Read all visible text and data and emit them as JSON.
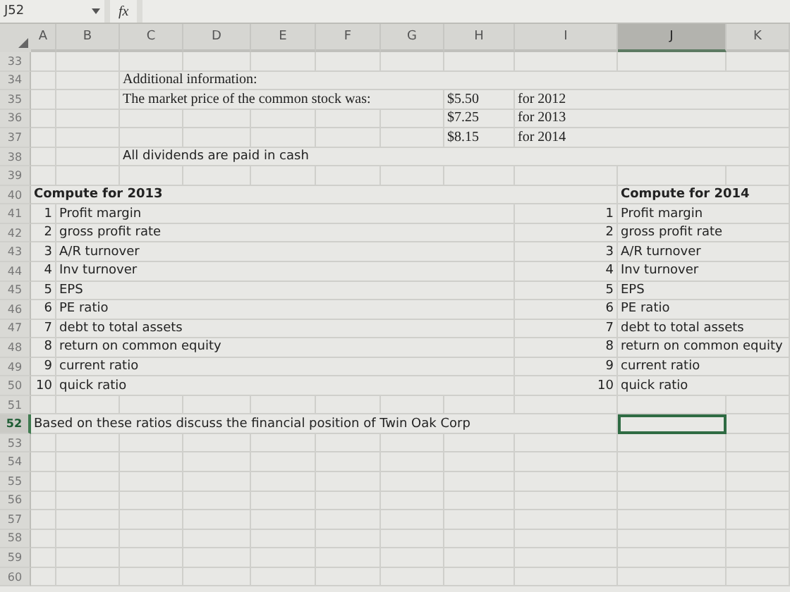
{
  "formula_bar": {
    "name_box": "J52",
    "function_label": "fx"
  },
  "columns": [
    {
      "letter": "A",
      "selected": false
    },
    {
      "letter": "B",
      "selected": false
    },
    {
      "letter": "C",
      "selected": false
    },
    {
      "letter": "D",
      "selected": false
    },
    {
      "letter": "E",
      "selected": false
    },
    {
      "letter": "F",
      "selected": false
    },
    {
      "letter": "G",
      "selected": false
    },
    {
      "letter": "H",
      "selected": false
    },
    {
      "letter": "I",
      "selected": false
    },
    {
      "letter": "J",
      "selected": true
    },
    {
      "letter": "K",
      "selected": false
    }
  ],
  "rows": [
    {
      "number": "33",
      "selected": false,
      "cells": {}
    },
    {
      "number": "34",
      "selected": false,
      "cells": {
        "C": {
          "kind": "typed",
          "text": "Additional information:"
        }
      }
    },
    {
      "number": "35",
      "selected": false,
      "cells": {
        "C": {
          "kind": "typed",
          "text": "The market price of the common stock was:"
        },
        "H": {
          "kind": "typed",
          "text": "$5.50"
        },
        "I": {
          "kind": "typed",
          "text": "for 2012"
        }
      }
    },
    {
      "number": "36",
      "selected": false,
      "cells": {
        "H": {
          "kind": "typed",
          "text": "$7.25"
        },
        "I": {
          "kind": "typed",
          "text": "for 2013"
        }
      }
    },
    {
      "number": "37",
      "selected": false,
      "cells": {
        "H": {
          "kind": "typed",
          "text": "$8.15"
        },
        "I": {
          "kind": "typed",
          "text": "for 2014"
        }
      }
    },
    {
      "number": "38",
      "selected": false,
      "cells": {
        "C": {
          "kind": "label",
          "text": "All dividends are paid in cash"
        }
      }
    },
    {
      "number": "39",
      "selected": false,
      "cells": {}
    },
    {
      "number": "40",
      "selected": false,
      "cells": {
        "A": {
          "kind": "heading",
          "text": "Compute for 2013"
        },
        "J": {
          "kind": "heading",
          "text": "Compute for 2014"
        }
      }
    },
    {
      "number": "41",
      "selected": false,
      "cells": {
        "A": {
          "kind": "index",
          "text": "1"
        },
        "B": {
          "kind": "label",
          "text": "Profit margin"
        },
        "I": {
          "kind": "index",
          "text": "1"
        },
        "J": {
          "kind": "label",
          "text": "Profit margin"
        }
      }
    },
    {
      "number": "42",
      "selected": false,
      "cells": {
        "A": {
          "kind": "index",
          "text": "2"
        },
        "B": {
          "kind": "label",
          "text": "gross profit rate"
        },
        "I": {
          "kind": "index",
          "text": "2"
        },
        "J": {
          "kind": "label",
          "text": "gross profit rate"
        }
      }
    },
    {
      "number": "43",
      "selected": false,
      "cells": {
        "A": {
          "kind": "index",
          "text": "3"
        },
        "B": {
          "kind": "label",
          "text": "A/R turnover"
        },
        "I": {
          "kind": "index",
          "text": "3"
        },
        "J": {
          "kind": "label",
          "text": "A/R turnover"
        }
      }
    },
    {
      "number": "44",
      "selected": false,
      "cells": {
        "A": {
          "kind": "index",
          "text": "4"
        },
        "B": {
          "kind": "label",
          "text": "Inv turnover"
        },
        "I": {
          "kind": "index",
          "text": "4"
        },
        "J": {
          "kind": "label",
          "text": "Inv turnover"
        }
      }
    },
    {
      "number": "45",
      "selected": false,
      "cells": {
        "A": {
          "kind": "index",
          "text": "5"
        },
        "B": {
          "kind": "label",
          "text": "EPS"
        },
        "I": {
          "kind": "index",
          "text": "5"
        },
        "J": {
          "kind": "label",
          "text": "EPS"
        }
      }
    },
    {
      "number": "46",
      "selected": false,
      "cells": {
        "A": {
          "kind": "index",
          "text": "6"
        },
        "B": {
          "kind": "label",
          "text": "PE ratio"
        },
        "I": {
          "kind": "index",
          "text": "6"
        },
        "J": {
          "kind": "label",
          "text": "PE ratio"
        }
      }
    },
    {
      "number": "47",
      "selected": false,
      "cells": {
        "A": {
          "kind": "index",
          "text": "7"
        },
        "B": {
          "kind": "label",
          "text": "debt to total assets"
        },
        "I": {
          "kind": "index",
          "text": "7"
        },
        "J": {
          "kind": "label",
          "text": "debt to total assets"
        }
      }
    },
    {
      "number": "48",
      "selected": false,
      "cells": {
        "A": {
          "kind": "index",
          "text": "8"
        },
        "B": {
          "kind": "label",
          "text": "return on common equity"
        },
        "I": {
          "kind": "index",
          "text": "8"
        },
        "J": {
          "kind": "label",
          "text": "return on common equity"
        }
      }
    },
    {
      "number": "49",
      "selected": false,
      "cells": {
        "A": {
          "kind": "index",
          "text": "9"
        },
        "B": {
          "kind": "label",
          "text": "current ratio"
        },
        "I": {
          "kind": "index",
          "text": "9"
        },
        "J": {
          "kind": "label",
          "text": "current ratio"
        }
      }
    },
    {
      "number": "50",
      "selected": false,
      "cells": {
        "A": {
          "kind": "index",
          "text": "10"
        },
        "B": {
          "kind": "label",
          "text": "quick ratio"
        },
        "I": {
          "kind": "index",
          "text": "10"
        },
        "J": {
          "kind": "label",
          "text": "quick ratio"
        }
      }
    },
    {
      "number": "51",
      "selected": false,
      "cells": {}
    },
    {
      "number": "52",
      "selected": true,
      "cells": {
        "A": {
          "kind": "label",
          "text": "Based on these ratios discuss the financial position of Twin Oak Corp"
        },
        "J": {
          "selected": true
        }
      }
    },
    {
      "number": "53",
      "selected": false,
      "cells": {}
    },
    {
      "number": "54",
      "selected": false,
      "cells": {}
    },
    {
      "number": "55",
      "selected": false,
      "cells": {}
    },
    {
      "number": "56",
      "selected": false,
      "cells": {}
    },
    {
      "number": "57",
      "selected": false,
      "cells": {}
    },
    {
      "number": "58",
      "selected": false,
      "cells": {}
    },
    {
      "number": "59",
      "selected": false,
      "cells": {}
    },
    {
      "number": "60",
      "selected": false,
      "cells": {}
    }
  ]
}
